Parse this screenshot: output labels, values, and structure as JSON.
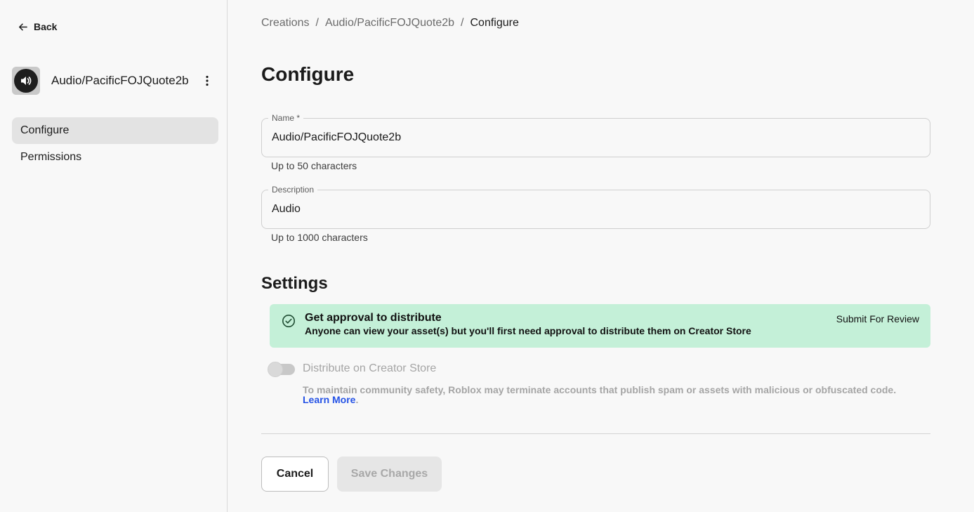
{
  "sidebar": {
    "back_label": "Back",
    "asset_name": "Audio/PacificFOJQuote2b",
    "nav": [
      {
        "label": "Configure",
        "active": true
      },
      {
        "label": "Permissions",
        "active": false
      }
    ]
  },
  "breadcrumb": {
    "items": [
      "Creations",
      "Audio/PacificFOJQuote2b"
    ],
    "current": "Configure",
    "separator": "/"
  },
  "page_title": "Configure",
  "form": {
    "name": {
      "label": "Name *",
      "value": "Audio/PacificFOJQuote2b",
      "helper": "Up to 50 characters"
    },
    "description": {
      "label": "Description",
      "value": "Audio",
      "helper": "Up to 1000 characters"
    }
  },
  "settings": {
    "title": "Settings",
    "banner": {
      "title": "Get approval to distribute",
      "text": "Anyone can view your asset(s) but you'll first need approval to distribute them on Creator Store",
      "action_label": "Submit For Review",
      "color": "#c4f0d8"
    },
    "distribute": {
      "label": "Distribute on Creator Store",
      "enabled": false,
      "description": "To maintain community safety, Roblox may terminate accounts that publish spam or assets with malicious or obfuscated code.",
      "link_label": "Learn More",
      "link_end": "."
    }
  },
  "actions": {
    "cancel_label": "Cancel",
    "save_label": "Save Changes"
  },
  "colors": {
    "link": "#2452e6",
    "success_banner": "#c4f0d8"
  }
}
